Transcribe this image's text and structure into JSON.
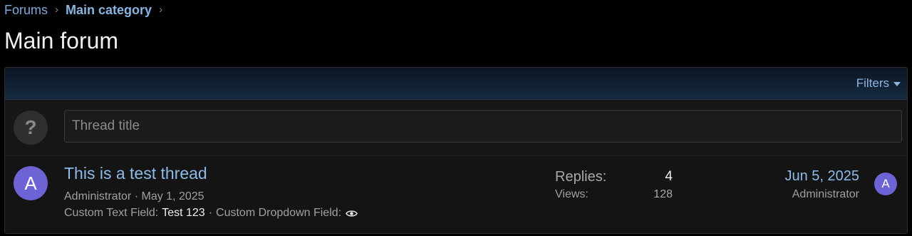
{
  "breadcrumb": {
    "items": [
      {
        "label": "Forums"
      },
      {
        "label": "Main category"
      }
    ],
    "separator": "›"
  },
  "page": {
    "title": "Main forum"
  },
  "filters": {
    "label": "Filters",
    "icon": "caret-down-icon"
  },
  "quick_thread": {
    "avatar_glyph": "?",
    "title_placeholder": "Thread title",
    "title_value": ""
  },
  "thread": {
    "avatar_letter": "A",
    "avatar_color": "#6e63d4",
    "title": "This is a test thread",
    "author": "Administrator",
    "meta_sep": "·",
    "date": "May 1, 2025",
    "custom_text_label": "Custom Text Field:",
    "custom_text_value": "Test 123",
    "custom_dropdown_label": "Custom Dropdown Field:",
    "custom_dropdown_icon": "eye-icon",
    "replies_label": "Replies:",
    "replies": "4",
    "views_label": "Views:",
    "views": "128",
    "last_post_date": "Jun 5, 2025",
    "last_post_user": "Administrator",
    "last_post_avatar_letter": "A"
  },
  "colors": {
    "accent": "#8cbbe8",
    "header_gradient_top": "#0c1522",
    "header_gradient_bottom": "#162b42",
    "avatar": "#6e63d4"
  }
}
